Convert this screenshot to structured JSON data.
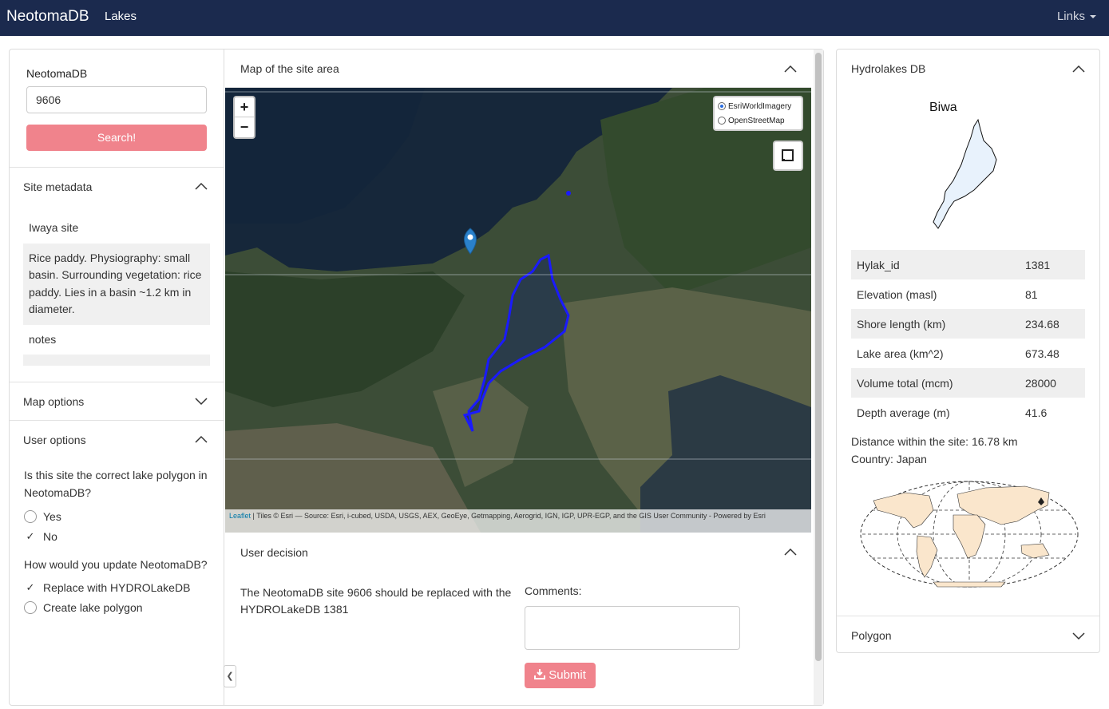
{
  "navbar": {
    "brand": "NeotomaDB",
    "tab": "Lakes",
    "links_label": "Links"
  },
  "sidebar": {
    "search_label": "NeotomaDB",
    "search_value": "9606",
    "search_button": "Search!",
    "site_metadata_title": "Site metadata",
    "site_name": "Iwaya site",
    "site_description": "Rice paddy. Physiography: small basin. Surrounding vegetation: rice paddy. Lies in a basin ~1.2 km in diameter.",
    "notes_label": "notes",
    "map_options_title": "Map options",
    "user_options_title": "User options",
    "question1": "Is this site the correct lake polygon in NeotomaDB?",
    "q1_options": [
      "Yes",
      "No"
    ],
    "q1_selected": "No",
    "question2": "How would you update NeotomaDB?",
    "q2_options": [
      "Replace with HYDROLakeDB",
      "Create lake polygon"
    ],
    "q2_selected": "Replace with HYDROLakeDB"
  },
  "main": {
    "map_title": "Map of the site area",
    "layers": [
      "EsriWorldImagery",
      "OpenStreetMap"
    ],
    "selected_layer": "EsriWorldImagery",
    "zoom_in": "+",
    "zoom_out": "−",
    "attribution_link": "Leaflet",
    "attribution_text": " | Tiles © Esri — Source: Esri, i-cubed, USDA, USGS, AEX, GeoEye, Getmapping, Aerogrid, IGN, IGP, UPR-EGP, and the GIS User Community - Powered by Esri",
    "decision_title": "User decision",
    "decision_text": "The NeotomaDB site 9606 should be replaced with the HYDROLakeDB 1381",
    "comments_label": "Comments:",
    "submit_label": "Submit"
  },
  "hydrolakes": {
    "title": "Hydrolakes DB",
    "lake_name": "Biwa",
    "rows": [
      {
        "label": "Hylak_id",
        "value": "1381"
      },
      {
        "label": "Elevation (masl)",
        "value": "81"
      },
      {
        "label": "Shore length (km)",
        "value": "234.68"
      },
      {
        "label": "Lake area (km^2)",
        "value": "673.48"
      },
      {
        "label": "Volume total (mcm)",
        "value": "28000"
      },
      {
        "label": "Depth average (m)",
        "value": "41.6"
      }
    ],
    "distance_text": "Distance within the site: 16.78 km",
    "country_text": "Country: Japan",
    "polygon_title": "Polygon"
  },
  "colors": {
    "navbar": "#1b2a4e",
    "accent_button": "#f0838c",
    "lake_outline": "#1a1aff",
    "marker": "#2a81cb"
  }
}
